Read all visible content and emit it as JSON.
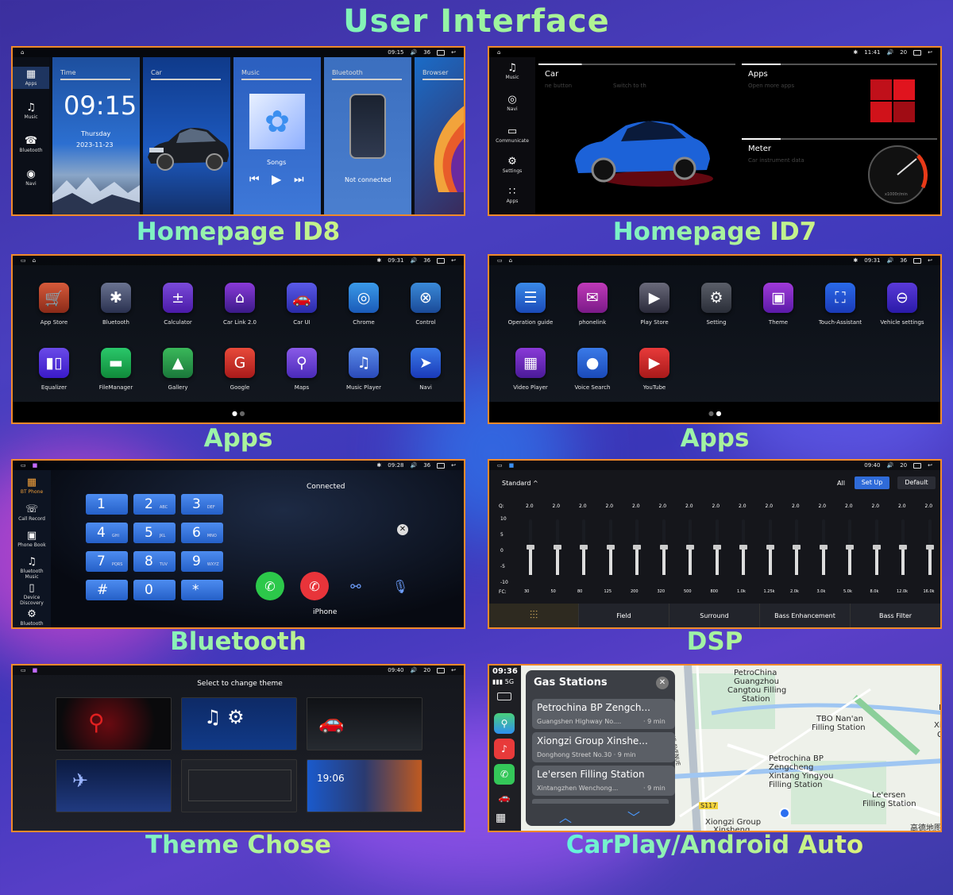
{
  "title": "User Interface",
  "captions": {
    "homepage_id8": "Homepage ID8",
    "homepage_id7": "Homepage ID7",
    "apps_left": "Apps",
    "apps_right": "Apps",
    "bluetooth": "Bluetooth",
    "dsp": "DSP",
    "theme": "Theme Chose",
    "carplay": "CarPlay/Android Auto"
  },
  "colors": {
    "frame": "#f08a2b",
    "accent_blue": "#2f6bd8"
  },
  "id8": {
    "status_time": "09:15",
    "status_volume": "36",
    "sidebar": [
      {
        "label": "Apps",
        "icon": "grid-icon"
      },
      {
        "label": "Music",
        "icon": "music-note-icon"
      },
      {
        "label": "Bluetooth",
        "icon": "phone-icon"
      },
      {
        "label": "Navi",
        "icon": "compass-icon"
      }
    ],
    "cards": {
      "time": {
        "label": "Time",
        "clock": "09:15",
        "day": "Thursday",
        "date": "2023-11-23"
      },
      "car": {
        "label": "Car"
      },
      "music": {
        "label": "Music",
        "song": "Songs"
      },
      "bluetooth": {
        "label": "Bluetooth",
        "status": "Not connected"
      },
      "browser": {
        "label": "Browser"
      }
    }
  },
  "id7": {
    "status_time": "11:41",
    "status_volume": "20",
    "sidebar": [
      {
        "label": "Music",
        "icon": "music-note-icon"
      },
      {
        "label": "Navi",
        "icon": "navigation-icon"
      },
      {
        "label": "Communicate",
        "icon": "chat-icon"
      },
      {
        "label": "Settings",
        "icon": "gear-icon"
      },
      {
        "label": "Apps",
        "icon": "apps-icon"
      }
    ],
    "car": {
      "title": "Car",
      "hint1": "ne button",
      "hint2": "Switch to th"
    },
    "apps": {
      "title": "Apps",
      "sub": "Open more apps"
    },
    "meter": {
      "title": "Meter",
      "sub": "Car instrument data",
      "unit": "x1000r/min"
    }
  },
  "apps1": {
    "status_time": "09:31",
    "status_volume": "36",
    "items": [
      {
        "label": "App Store",
        "icon": "cart-icon",
        "glyph": "🛒"
      },
      {
        "label": "Bluetooth",
        "icon": "bluetooth-icon",
        "glyph": "✱"
      },
      {
        "label": "Calculator",
        "icon": "calculator-icon",
        "glyph": "±"
      },
      {
        "label": "Car Link 2.0",
        "icon": "car-link-icon",
        "glyph": "⌂"
      },
      {
        "label": "Car UI",
        "icon": "car-icon",
        "glyph": "🚗"
      },
      {
        "label": "Chrome",
        "icon": "chrome-icon",
        "glyph": "◎"
      },
      {
        "label": "Control",
        "icon": "steering-wheel-icon",
        "glyph": "⊗"
      },
      {
        "label": "Equalizer",
        "icon": "equalizer-icon",
        "glyph": "▮▯"
      },
      {
        "label": "FileManager",
        "icon": "folder-icon",
        "glyph": "▬"
      },
      {
        "label": "Gallery",
        "icon": "gallery-icon",
        "glyph": "▲"
      },
      {
        "label": "Google",
        "icon": "google-icon",
        "glyph": "G"
      },
      {
        "label": "Maps",
        "icon": "maps-icon",
        "glyph": "⚲"
      },
      {
        "label": "Music Player",
        "icon": "music-player-icon",
        "glyph": "♫"
      },
      {
        "label": "Navi",
        "icon": "navi-icon",
        "glyph": "➤"
      }
    ]
  },
  "apps2": {
    "status_time": "09:31",
    "status_volume": "36",
    "items": [
      {
        "label": "Operation guide",
        "icon": "guide-icon",
        "glyph": "☰"
      },
      {
        "label": "phonelink",
        "icon": "phonelink-icon",
        "glyph": "✉"
      },
      {
        "label": "Play Store",
        "icon": "play-store-icon",
        "glyph": "▶"
      },
      {
        "label": "Setting",
        "icon": "gear-icon",
        "glyph": "⚙"
      },
      {
        "label": "Theme",
        "icon": "theme-icon",
        "glyph": "▣"
      },
      {
        "label": "Touch-Assistant",
        "icon": "touch-assistant-icon",
        "glyph": "⛶"
      },
      {
        "label": "Vehicle settings",
        "icon": "vehicle-icon",
        "glyph": "⊖"
      },
      {
        "label": "Video Player",
        "icon": "video-icon",
        "glyph": "▦"
      },
      {
        "label": "Voice Search",
        "icon": "microphone-icon",
        "glyph": "●"
      },
      {
        "label": "YouTube",
        "icon": "youtube-icon",
        "glyph": "▶"
      }
    ]
  },
  "bt": {
    "status_time": "09:28",
    "status_volume": "36",
    "sidebar": [
      "BT Phone",
      "Call Record",
      "Phone Book",
      "Bluetooth Music",
      "Device Discovery",
      "Bluetooth"
    ],
    "status": "Connected",
    "device": "iPhone",
    "keys": [
      {
        "d": "1",
        "s": ""
      },
      {
        "d": "2",
        "s": "ABC"
      },
      {
        "d": "3",
        "s": "DEF"
      },
      {
        "d": "4",
        "s": "GHI"
      },
      {
        "d": "5",
        "s": "JKL"
      },
      {
        "d": "6",
        "s": "MNO"
      },
      {
        "d": "7",
        "s": "PQRS"
      },
      {
        "d": "8",
        "s": "TUV"
      },
      {
        "d": "9",
        "s": "WXYZ"
      },
      {
        "d": "#",
        "s": ""
      },
      {
        "d": "0",
        "s": ""
      },
      {
        "d": "*",
        "s": ""
      }
    ]
  },
  "dsp": {
    "status_time": "09:40",
    "status_volume": "20",
    "preset": "Standard ^",
    "all": "All",
    "setup": "Set Up",
    "default": "Default",
    "q_label": "Q:",
    "fc_label": "FC:",
    "q_values": [
      "2.0",
      "2.0",
      "2.0",
      "2.0",
      "2.0",
      "2.0",
      "2.0",
      "2.0",
      "2.0",
      "2.0",
      "2.0",
      "2.0",
      "2.0",
      "2.0",
      "2.0",
      "2.0"
    ],
    "scale": [
      "10",
      "5",
      "0",
      "-5",
      "-10"
    ],
    "freqs": [
      "30",
      "50",
      "80",
      "125",
      "200",
      "320",
      "500",
      "800",
      "1.0k",
      "1.25k",
      "2.0k",
      "3.0k",
      "5.0k",
      "8.0k",
      "12.0k",
      "16.0k"
    ],
    "tabs": [
      "Field",
      "Surround",
      "Bass Enhancement",
      "Bass Filter"
    ]
  },
  "theme": {
    "status_time": "09:40",
    "status_volume": "20",
    "title": "Select to change theme",
    "thumb_clock": "19:06"
  },
  "carplay": {
    "time": "09:36",
    "signal": "5G",
    "panel_title": "Gas Stations",
    "stations": [
      {
        "name": "Petrochina BP Zengch...",
        "addr": "Guangshen Highway No....",
        "eta": "· 9 min"
      },
      {
        "name": "Xiongzi Group Xinshe...",
        "addr": "Donghong Street No.30 · 9 min",
        "eta": ""
      },
      {
        "name": "Le'ersen Filling Station",
        "addr": "Xintangzhen Wenchong...",
        "eta": "· 9 min"
      }
    ],
    "map_labels": [
      "PetroChina",
      "Guangzhou",
      "Cangtou Filling",
      "Station",
      "TBO Nan'an",
      "Filling Station",
      "Petrochina BP",
      "Zengcheng",
      "Xintang Yingyou",
      "Filling Station",
      "Le'ersen",
      "Filling Station",
      "Xiongzi Group",
      "Xinsheng",
      "HUANG AVENUE",
      "S117",
      "高德地图",
      "F",
      "Xi",
      "C"
    ]
  }
}
